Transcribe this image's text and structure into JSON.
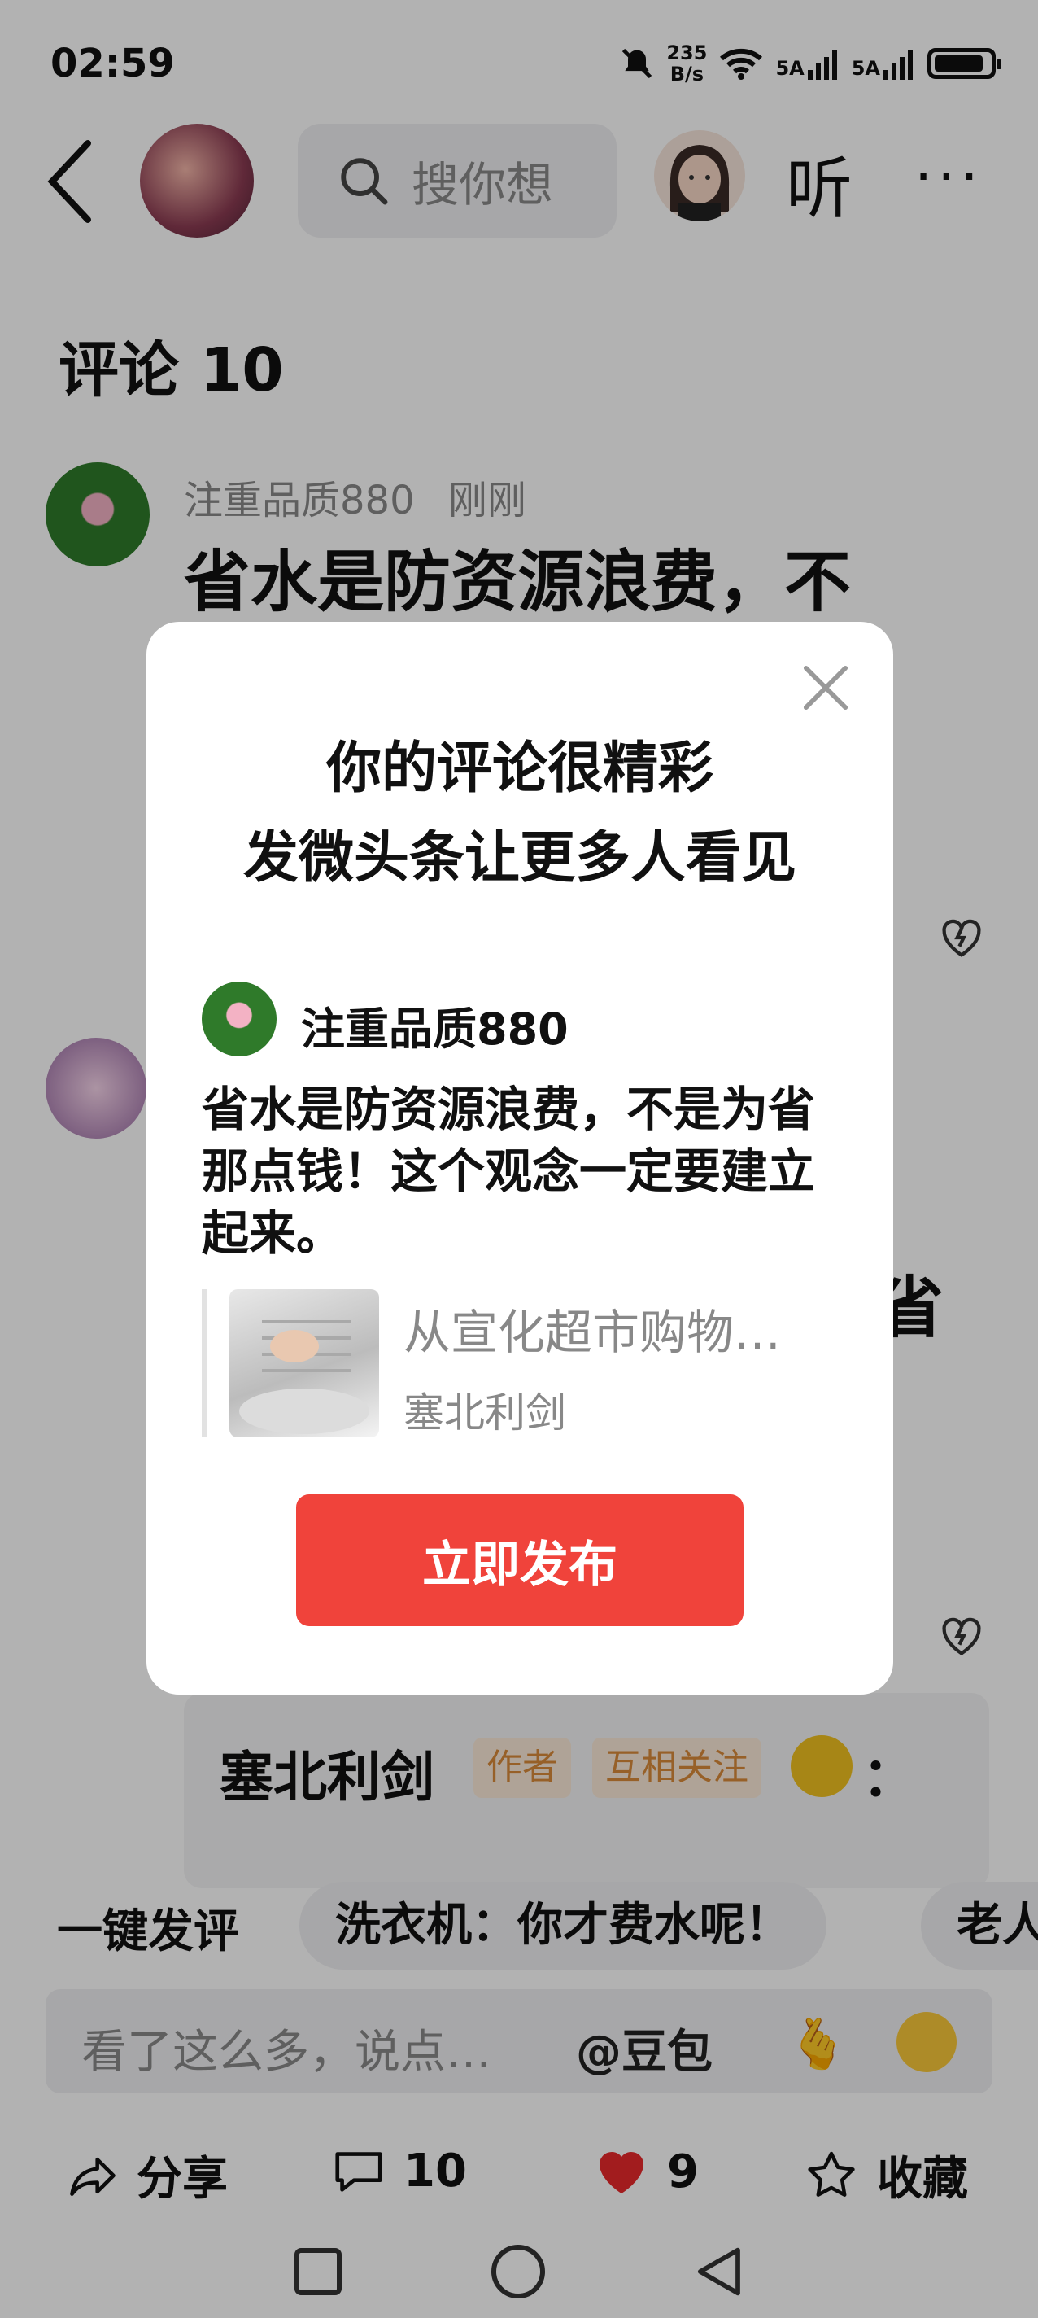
{
  "status_bar": {
    "time": "02:59",
    "net_speed_top": "235",
    "net_speed_unit": "B/s",
    "sig1": "5A",
    "sig2": "5A"
  },
  "header": {
    "search_placeholder": "搜你想",
    "listen_label": "听",
    "more_label": "···"
  },
  "comments": {
    "title": "评论 10",
    "first": {
      "user": "注重品质880",
      "time": "刚刚",
      "text_visible": "省水是防资源浪费，不"
    },
    "second_tail_char": "省",
    "reply": {
      "author": "塞北利剑",
      "tag_author": "作者",
      "tag_follow": "互相关注",
      "colon": "："
    }
  },
  "quick_comment": {
    "label": "一键发评",
    "chips": [
      "洗衣机：你才费水呢！",
      "老人"
    ]
  },
  "input": {
    "placeholder": "看了这么多，说点…",
    "mention": "@豆包",
    "emoji1": "🫰"
  },
  "actions": {
    "share": "分享",
    "comments_count": "10",
    "likes_count": "9",
    "favorite": "收藏"
  },
  "modal": {
    "title_line1": "你的评论很精彩",
    "title_line2": "发微头条让更多人看见",
    "user": "注重品质880",
    "comment": "省水是防资源浪费，不是为省那点钱！这个观念一定要建立起来。",
    "article_title": "从宣化超市购物…",
    "article_author": "塞北利剑",
    "publish_label": "立即发布"
  },
  "colors": {
    "accent_red": "#f0433b",
    "heart_red": "#e8292c",
    "tag_orange": "#d88a3a"
  }
}
